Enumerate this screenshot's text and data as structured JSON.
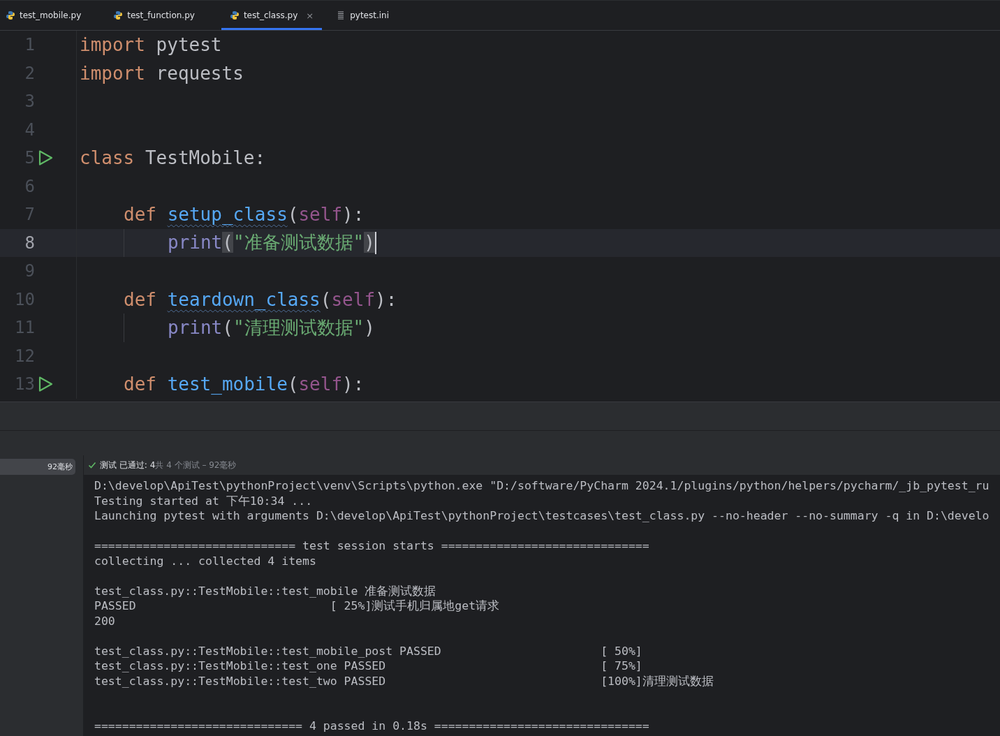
{
  "tabs": [
    {
      "label": "test_mobile.py",
      "kind": "python",
      "selected": false,
      "closable": false
    },
    {
      "label": "test_function.py",
      "kind": "python",
      "selected": false,
      "closable": false
    },
    {
      "label": "test_class.py",
      "kind": "python",
      "selected": true,
      "closable": true,
      "close": "×"
    },
    {
      "label": "pytest.ini",
      "kind": "ini",
      "selected": false,
      "closable": false
    }
  ],
  "editor": {
    "lines": [
      {
        "number": "1",
        "kind": "top",
        "current": false,
        "run": false,
        "tokens": [
          {
            "kind": "keyword",
            "text": "import"
          },
          {
            "kind": "plain",
            "text": " pytest"
          }
        ]
      },
      {
        "number": "2",
        "kind": "top",
        "current": false,
        "run": false,
        "tokens": [
          {
            "kind": "keyword",
            "text": "import"
          },
          {
            "kind": "plain",
            "text": " requests"
          }
        ]
      },
      {
        "number": "3",
        "kind": "top",
        "current": false,
        "run": false
      },
      {
        "number": "4",
        "kind": "top",
        "current": false,
        "run": false
      },
      {
        "number": "5",
        "kind": "top",
        "current": false,
        "run": true,
        "tokens": [
          {
            "kind": "keyword",
            "text": "class"
          },
          {
            "kind": "plain",
            "text": " TestMobile:"
          }
        ]
      },
      {
        "number": "6",
        "kind": "top",
        "current": false,
        "run": false
      },
      {
        "number": "7",
        "kind": "method",
        "current": false,
        "run": false,
        "tokens": [
          {
            "kind": "keyword",
            "text": "def "
          },
          {
            "kind": "function",
            "text": "setup_class",
            "underlined": true
          },
          {
            "kind": "plain",
            "text": "("
          },
          {
            "kind": "self",
            "text": "self"
          },
          {
            "kind": "plain",
            "text": "):"
          }
        ]
      },
      {
        "number": "8",
        "kind": "body",
        "current": true,
        "run": false,
        "tokens": [
          {
            "kind": "builtin",
            "text": "print"
          },
          {
            "kind": "bracket",
            "text": "("
          },
          {
            "kind": "string",
            "text": "\"准备测试数据\""
          },
          {
            "kind": "bracket",
            "text": ")"
          }
        ]
      },
      {
        "number": "9",
        "kind": "top",
        "current": false,
        "run": false
      },
      {
        "number": "10",
        "kind": "method",
        "current": false,
        "run": false,
        "tokens": [
          {
            "kind": "keyword",
            "text": "def "
          },
          {
            "kind": "function",
            "text": "teardown_class",
            "underlined": true
          },
          {
            "kind": "plain",
            "text": "("
          },
          {
            "kind": "self",
            "text": "self"
          },
          {
            "kind": "plain",
            "text": "):"
          }
        ]
      },
      {
        "number": "11",
        "kind": "body",
        "current": false,
        "run": false,
        "tokens": [
          {
            "kind": "builtin",
            "text": "print"
          },
          {
            "kind": "plain",
            "text": "("
          },
          {
            "kind": "string",
            "text": "\"清理测试数据\""
          },
          {
            "kind": "plain",
            "text": ")"
          }
        ]
      },
      {
        "number": "12",
        "kind": "top",
        "current": false,
        "run": false
      },
      {
        "number": "13",
        "kind": "method",
        "current": false,
        "run": true,
        "tokens": [
          {
            "kind": "keyword",
            "text": "def "
          },
          {
            "kind": "function",
            "text": "test_mobile"
          },
          {
            "kind": "plain",
            "text": "("
          },
          {
            "kind": "self",
            "text": "self"
          },
          {
            "kind": "plain",
            "text": "):"
          }
        ]
      }
    ]
  },
  "test_bar": {
    "duration": "92毫秒",
    "passed": true,
    "status": "测试 已通过: 4",
    "summary": "共 4 个测试 – 92毫秒"
  },
  "console": {
    "lines": [
      {
        "kind": "plain",
        "text": "D:\\develop\\ApiTest\\pythonProject\\venv\\Scripts\\python.exe \"D:/software/PyCharm 2024.1/plugins/python/helpers/pycharm/_jb_pytest_ru"
      },
      {
        "kind": "plain",
        "text": "Testing started at 下午10:34 ..."
      },
      {
        "kind": "plain",
        "text": "Launching pytest with arguments D:\\develop\\ApiTest\\pythonProject\\testcases\\test_class.py --no-header --no-summary -q in D:\\develo"
      },
      {
        "kind": "spaced",
        "text": "============================= test session starts =============================="
      },
      {
        "kind": "plain",
        "text": "collecting ... collected 4 items"
      },
      {
        "kind": "spaced",
        "text": "test_class.py::TestMobile::test_mobile 准备测试数据"
      },
      {
        "kind": "plain",
        "text": "PASSED                            [ 25%]测试手机归属地get请求"
      },
      {
        "kind": "plain",
        "text": "200"
      },
      {
        "kind": "spaced",
        "text": "test_class.py::TestMobile::test_mobile_post PASSED                       [ 50%]"
      },
      {
        "kind": "plain",
        "text": "test_class.py::TestMobile::test_one PASSED                               [ 75%]"
      },
      {
        "kind": "plain",
        "text": "test_class.py::TestMobile::test_two PASSED                               [100%]清理测试数据"
      },
      {
        "kind": "footer",
        "text": "============================== 4 passed in 0.18s ==============================="
      }
    ]
  }
}
